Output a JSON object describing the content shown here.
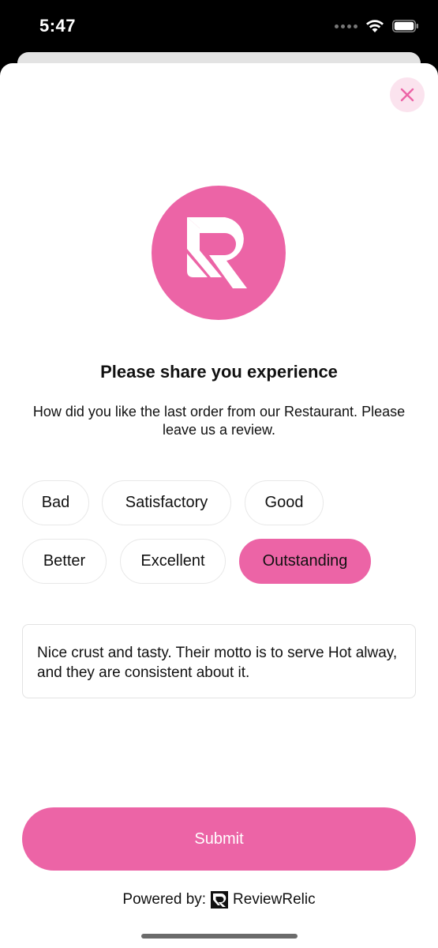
{
  "status_bar": {
    "time": "5:47"
  },
  "close_button": {
    "icon": "close-icon"
  },
  "logo": {
    "icon": "reviewrelic-logo-icon"
  },
  "header": {
    "title": "Please share you experience",
    "subtitle": "How did you like the last order from our Restaurant. Please leave us a review."
  },
  "ratings": {
    "options": [
      "Bad",
      "Satisfactory",
      "Good",
      "Better",
      "Excellent",
      "Outstanding"
    ],
    "selected": "Outstanding"
  },
  "review": {
    "text": "Nice crust and tasty. Their motto is to serve Hot alway, and they are consistent about it."
  },
  "submit": {
    "label": "Submit"
  },
  "footer": {
    "powered_label": "Powered by:",
    "brand": "ReviewRelic"
  },
  "colors": {
    "accent": "#ec64a6",
    "accent_light": "#fbe3ee"
  }
}
